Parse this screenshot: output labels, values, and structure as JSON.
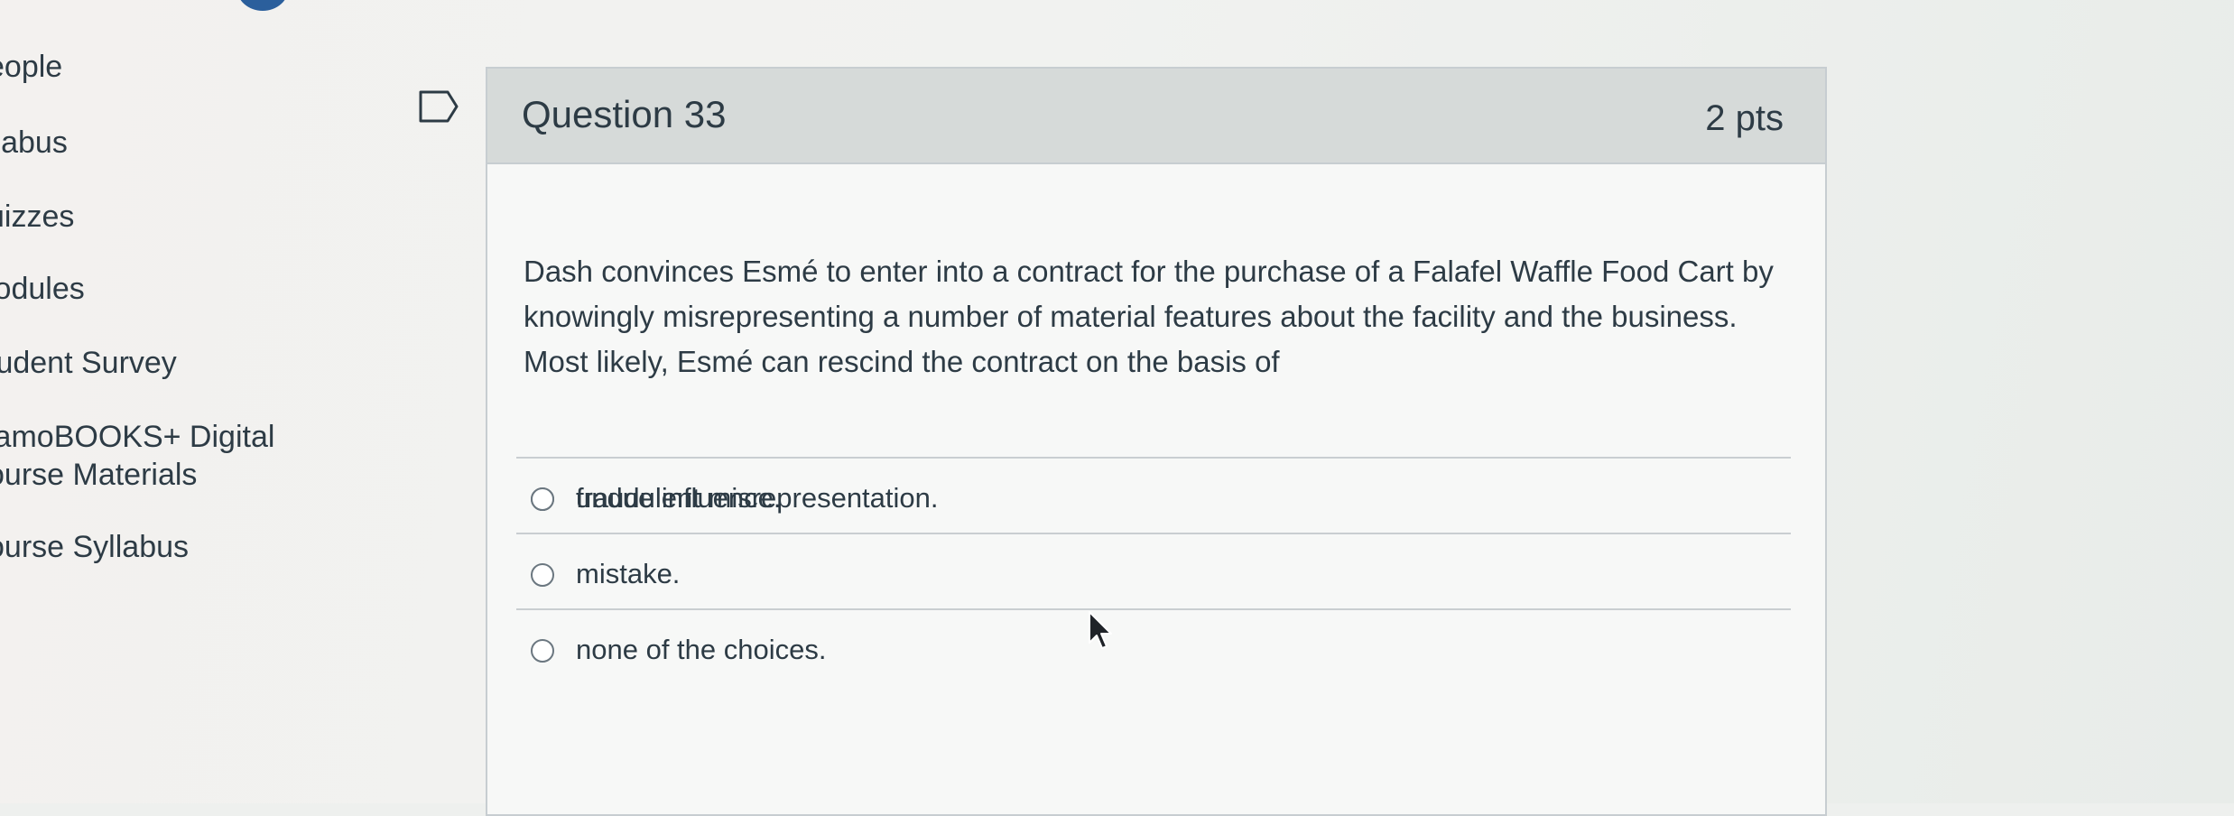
{
  "course_nav": {
    "items": [
      {
        "label": "eople"
      },
      {
        "label": "llabus"
      },
      {
        "label": "uizzes"
      },
      {
        "label": "lodules"
      },
      {
        "label": "tudent Survey"
      },
      {
        "label": "lamoBOOKS+ Digital"
      },
      {
        "label": "ourse Materials"
      },
      {
        "label": "ourse Syllabus"
      }
    ]
  },
  "question": {
    "title": "Question 33",
    "points": "2 pts",
    "text": "Dash convinces Esmé to enter into a contract for the purchase of a Falafel Waffle Food Cart by knowingly misrepresenting a number of material features about the facility and the business. Most likely, Esmé can rescind the contract on the basis of",
    "answers": [
      {
        "label": "fraudulent misrepresentation."
      },
      {
        "label": "undue influence."
      },
      {
        "label": "mistake."
      },
      {
        "label": "none of the choices."
      }
    ]
  },
  "icons": {
    "flag": "flag-icon",
    "radio": "radio-button-icon",
    "cursor": "mouse-pointer-icon"
  },
  "colors": {
    "text": "#2d3b45",
    "header_bg": "#d6dad9",
    "border": "#c7cdd1",
    "badge": "#2b5f9c"
  }
}
